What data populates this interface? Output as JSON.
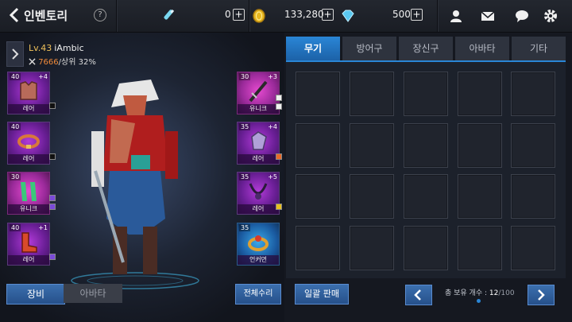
{
  "header": {
    "title": "인벤토리",
    "help": "?",
    "currencies": [
      {
        "icon": "potion-icon",
        "value": "0"
      },
      {
        "icon": "gold-coin-icon",
        "value": "133,280"
      },
      {
        "icon": "diamond-icon",
        "value": "500"
      }
    ],
    "plus": "+"
  },
  "character": {
    "level": "Lv.43",
    "name": "iAmbic",
    "power": "7666",
    "rank": "/상위 32%"
  },
  "left_slots": [
    {
      "lv": "40",
      "enchant": "+4",
      "grade": "레어"
    },
    {
      "lv": "40",
      "enchant": "",
      "grade": "레어"
    },
    {
      "lv": "30",
      "enchant": "",
      "grade": "유니크"
    },
    {
      "lv": "40",
      "enchant": "+1",
      "grade": "레어"
    }
  ],
  "right_slots": [
    {
      "lv": "30",
      "enchant": "+3",
      "grade": "유니크"
    },
    {
      "lv": "35",
      "enchant": "+4",
      "grade": "레어"
    },
    {
      "lv": "35",
      "enchant": "+5",
      "grade": "레어"
    },
    {
      "lv": "35",
      "enchant": "",
      "grade": "언커먼"
    }
  ],
  "left_buttons": {
    "equip": "장비",
    "avatar": "아바타",
    "repair_all": "전체수리"
  },
  "tabs": [
    "무기",
    "방어구",
    "장신구",
    "아바타",
    "기타"
  ],
  "bottom": {
    "sell_all": "일괄 판매",
    "count_label": "총 보유 개수 : ",
    "count_current": "12",
    "count_max": "/100"
  },
  "colors": {
    "accent": "#2a86d6",
    "rare": "#8a2fc0",
    "unique": "#c83ab8",
    "uncommon": "#2a78c8"
  }
}
